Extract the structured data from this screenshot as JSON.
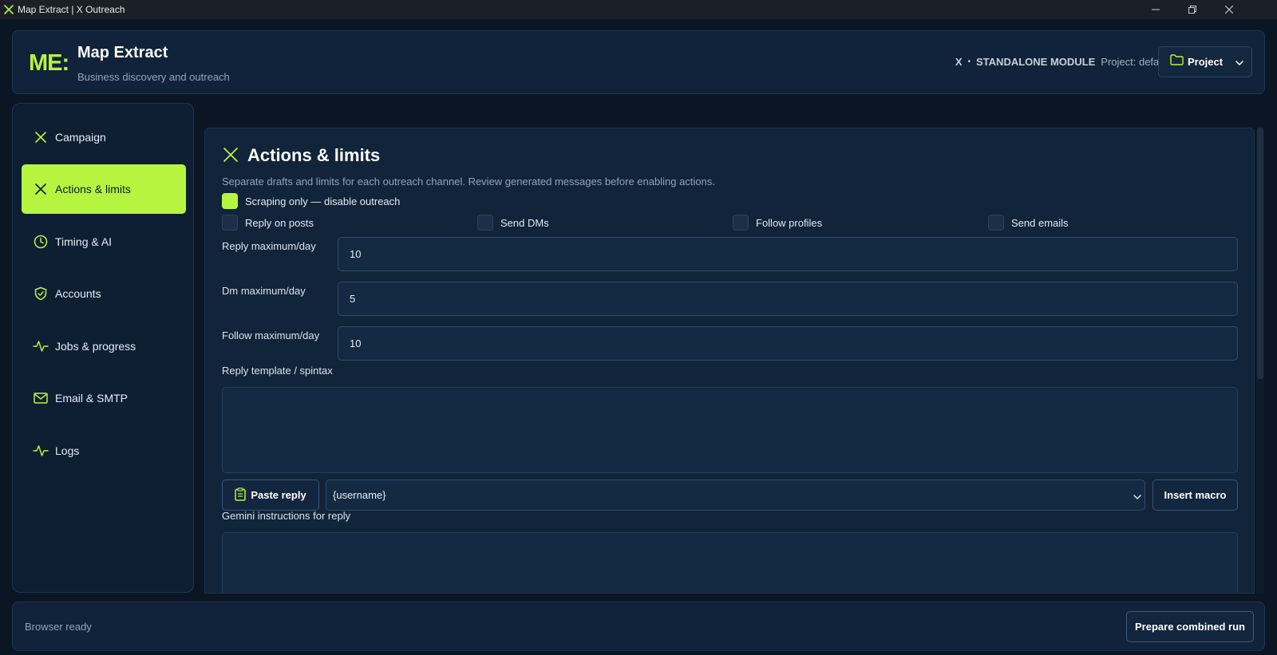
{
  "window": {
    "title": "Map Extract | X Outreach",
    "controls": [
      "minimize",
      "restore",
      "close"
    ]
  },
  "header": {
    "logo": "ME:",
    "title": "Map Extract",
    "subtitle": "Business discovery and outreach",
    "module_x": "X",
    "separator": "•",
    "module_label": "STANDALONE MODULE",
    "project_text": "Project: default",
    "project_button": "Project"
  },
  "sidebar": {
    "items": [
      {
        "label": "Campaign",
        "icon": "x-icon",
        "active": false
      },
      {
        "label": "Actions & limits",
        "icon": "x-icon",
        "active": true
      },
      {
        "label": "Timing & AI",
        "icon": "clock-icon",
        "active": false
      },
      {
        "label": "Accounts",
        "icon": "shield-check-icon",
        "active": false
      },
      {
        "label": "Jobs & progress",
        "icon": "activity-icon",
        "active": false
      },
      {
        "label": "Email & SMTP",
        "icon": "mail-icon",
        "active": false
      },
      {
        "label": "Logs",
        "icon": "activity-icon",
        "active": false
      }
    ]
  },
  "main": {
    "title": "Actions & limits",
    "description": "Separate drafts and limits for each outreach channel. Review generated messages before enabling actions.",
    "scraping_only": {
      "label": "Scraping only — disable outreach",
      "checked": true
    },
    "toggles": [
      {
        "label": "Reply on posts",
        "checked": false
      },
      {
        "label": "Send DMs",
        "checked": false
      },
      {
        "label": "Follow profiles",
        "checked": false
      },
      {
        "label": "Send emails",
        "checked": false
      }
    ],
    "limits": [
      {
        "label": "Reply maximum/day",
        "value": "10"
      },
      {
        "label": "Dm maximum/day",
        "value": "5"
      },
      {
        "label": "Follow maximum/day",
        "value": "10"
      }
    ],
    "reply_template_label": "Reply template / spintax",
    "reply_template_value": "",
    "paste_reply_button": "Paste reply",
    "macro_select_value": "{username}",
    "insert_macro_button": "Insert macro",
    "gemini_label": "Gemini instructions for reply",
    "gemini_value": ""
  },
  "footer": {
    "status": "Browser ready",
    "run_button": "Prepare combined run"
  },
  "colors": {
    "accent": "#b7f43f",
    "background": "#0b1624",
    "panel": "#11243a",
    "input": "#142a43"
  }
}
